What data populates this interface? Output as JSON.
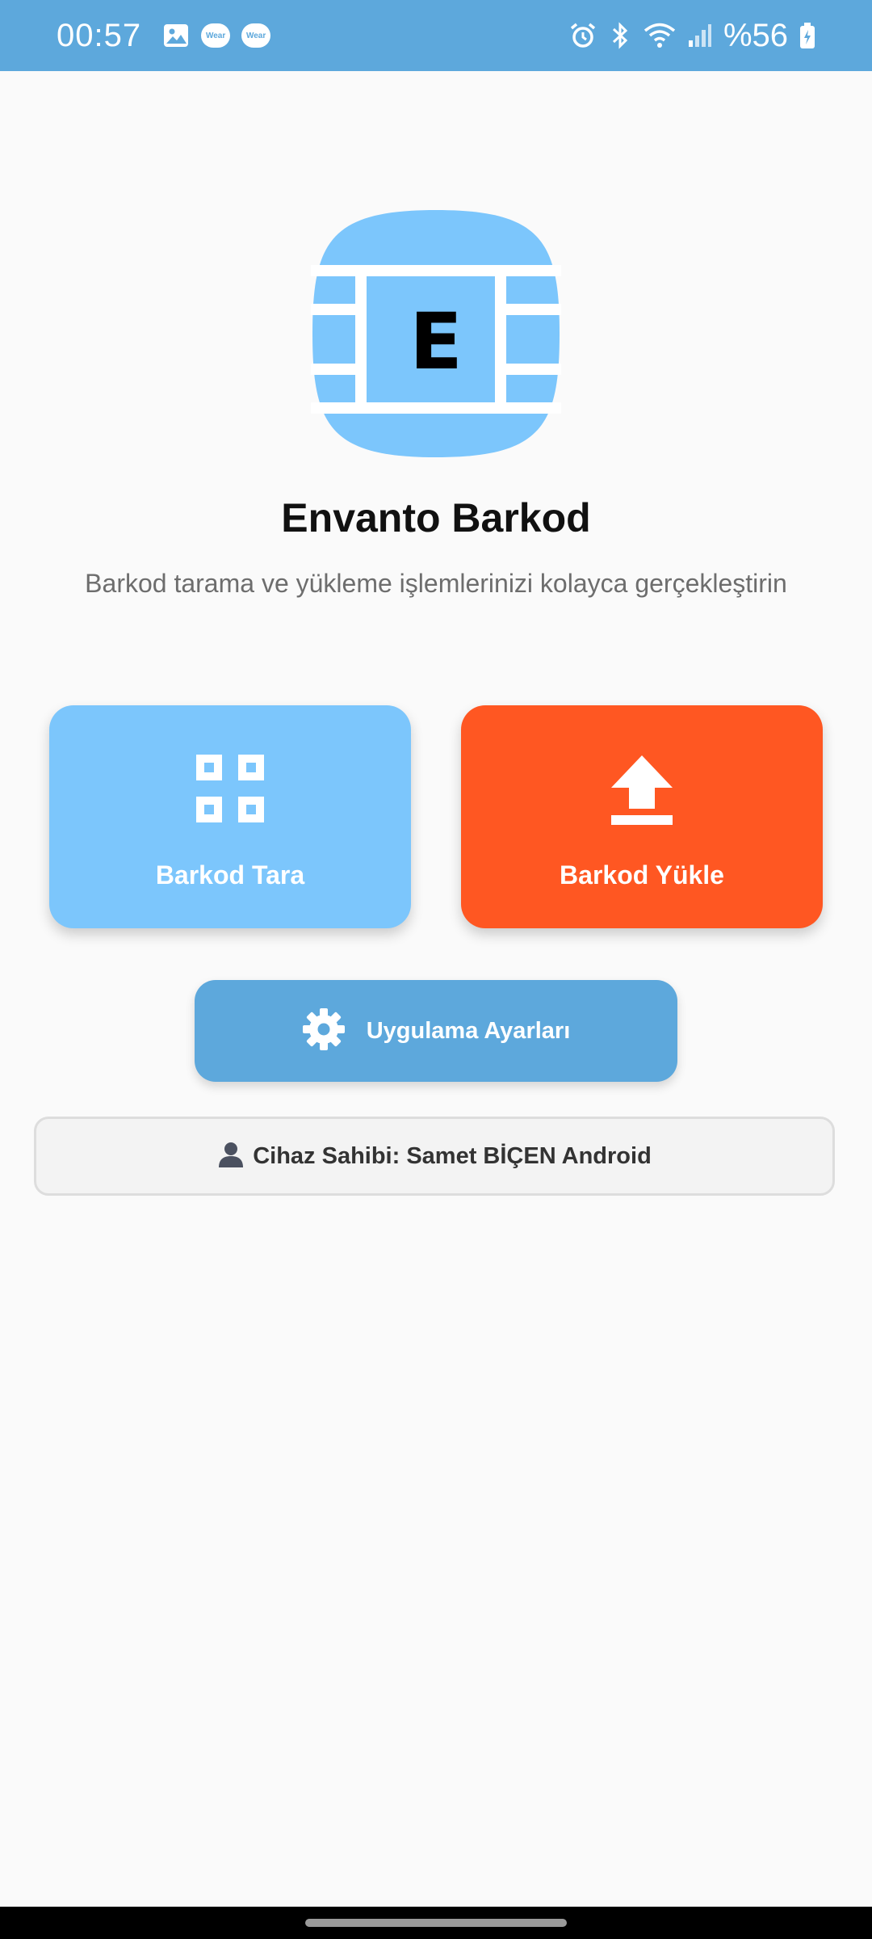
{
  "status_bar": {
    "time": "00:57",
    "wear_label": "Wear",
    "battery": "%56",
    "icons": [
      "gallery-icon",
      "wear-icon",
      "wear-icon",
      "alarm-icon",
      "bluetooth-icon",
      "wifi-icon",
      "signal-icon",
      "battery-icon"
    ]
  },
  "app": {
    "logo_letter": "E",
    "title": "Envanto Barkod",
    "subtitle": "Barkod tarama ve yükleme işlemlerinizi kolayca gerçekleştirin"
  },
  "actions": {
    "scan": {
      "label": "Barkod Tara",
      "icon": "qr-grid-icon",
      "color": "#7cc6fc"
    },
    "upload": {
      "label": "Barkod Yükle",
      "icon": "upload-icon",
      "color": "#ff5722"
    }
  },
  "settings": {
    "label": "Uygulama Ayarları",
    "icon": "gear-icon",
    "color": "#5da8dc"
  },
  "owner": {
    "icon": "person-icon",
    "text": "Cihaz Sahibi: Samet BİÇEN Android"
  },
  "colors": {
    "status_bar": "#5da8dc",
    "background": "#fafafa",
    "logo": "#7cc6fc"
  }
}
